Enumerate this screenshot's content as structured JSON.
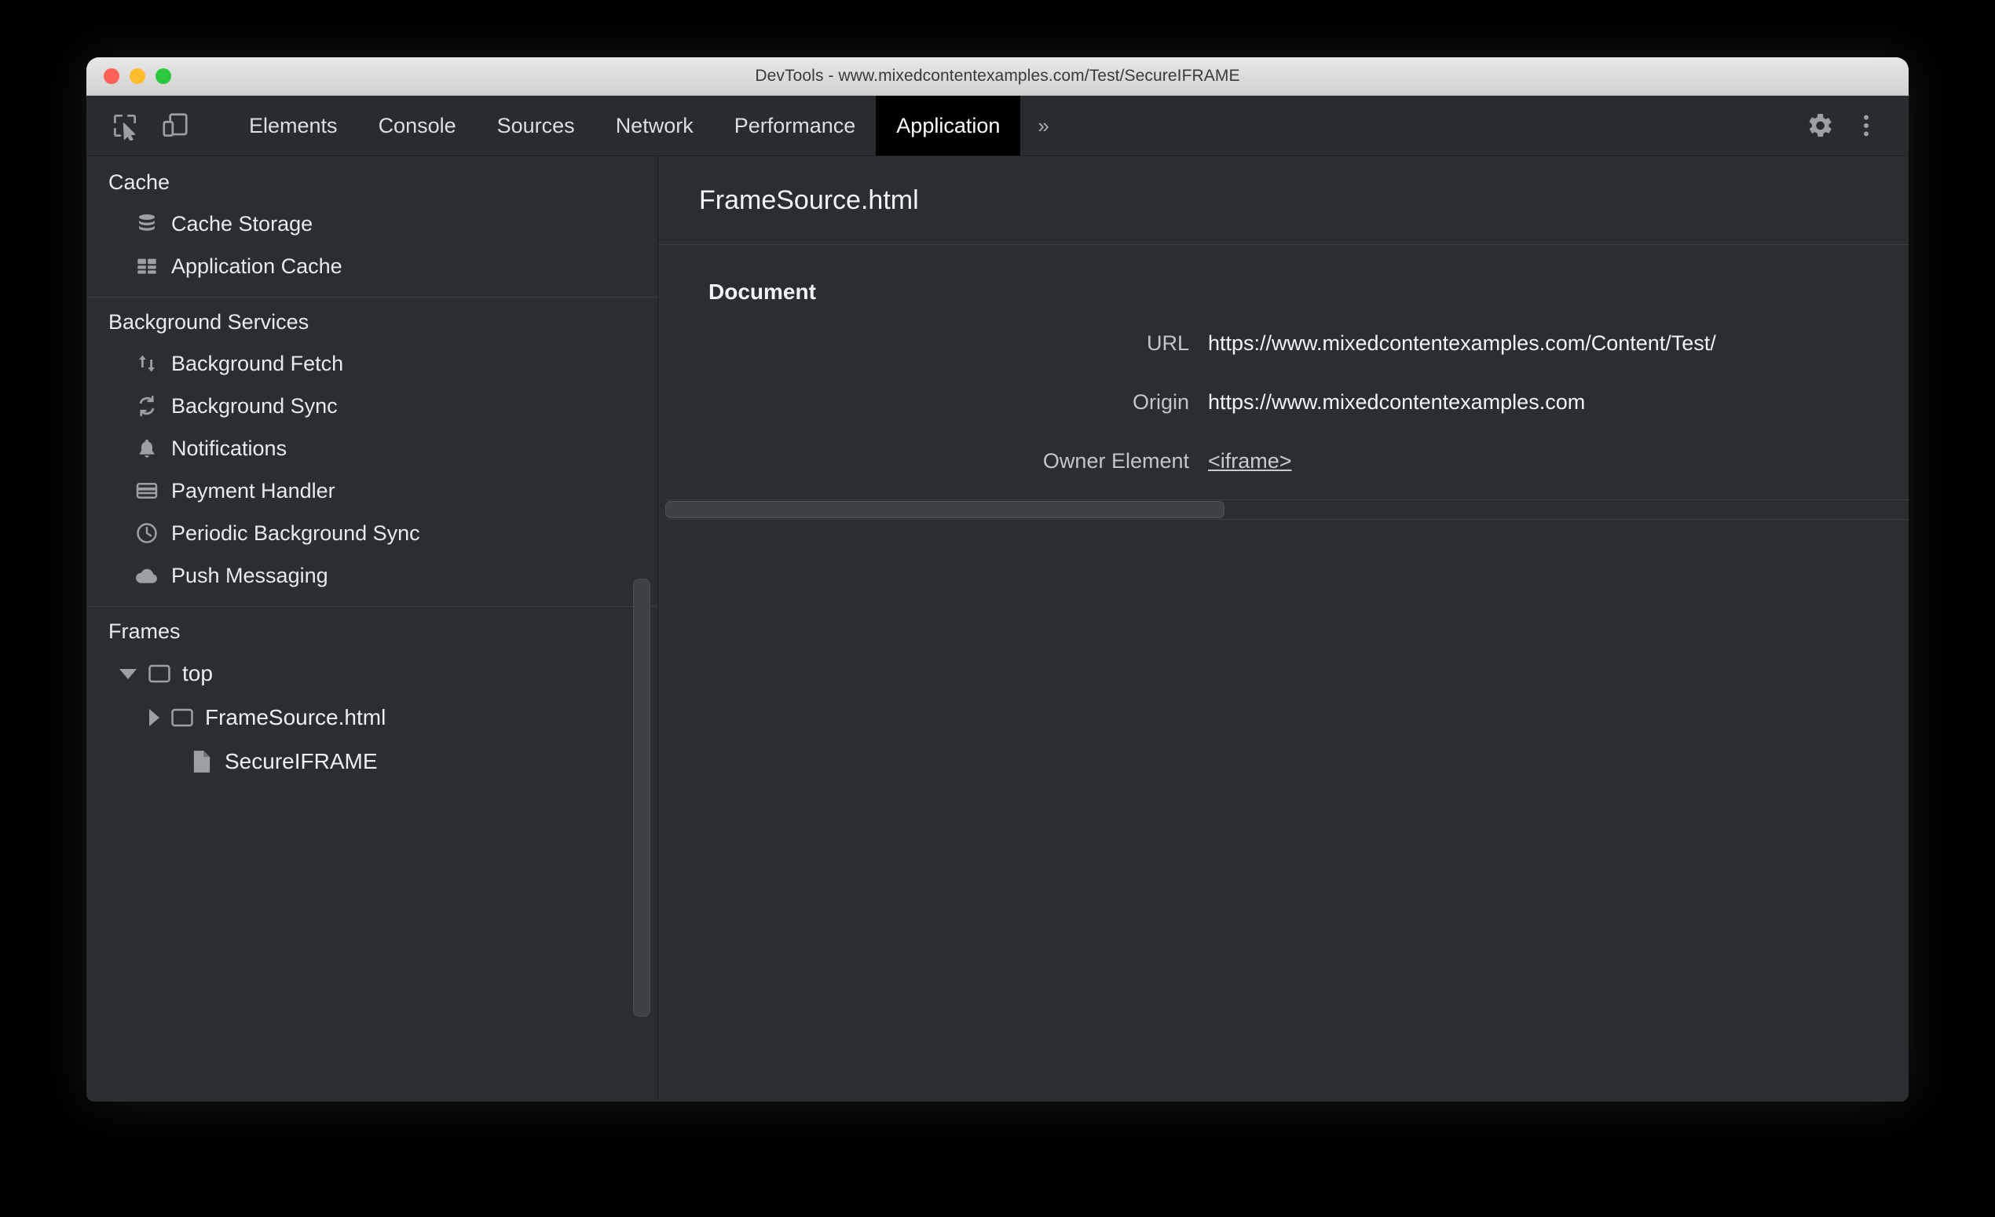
{
  "window": {
    "title": "DevTools - www.mixedcontentexamples.com/Test/SecureIFRAME"
  },
  "toolbar": {
    "inspect_icon": "inspect-element-icon",
    "device_icon": "device-toolbar-icon",
    "settings_icon": "gear-icon",
    "menu_icon": "more-vertical-icon",
    "more_tabs_label": "»",
    "tabs": [
      {
        "label": "Elements",
        "selected": false
      },
      {
        "label": "Console",
        "selected": false
      },
      {
        "label": "Sources",
        "selected": false
      },
      {
        "label": "Network",
        "selected": false
      },
      {
        "label": "Performance",
        "selected": false
      },
      {
        "label": "Application",
        "selected": true
      }
    ]
  },
  "sidebar": {
    "sections": [
      {
        "title": "Cache",
        "items": [
          {
            "label": "Cache Storage",
            "icon": "database-icon"
          },
          {
            "label": "Application Cache",
            "icon": "grid-icon"
          }
        ]
      },
      {
        "title": "Background Services",
        "items": [
          {
            "label": "Background Fetch",
            "icon": "arrows-up-down-icon"
          },
          {
            "label": "Background Sync",
            "icon": "sync-icon"
          },
          {
            "label": "Notifications",
            "icon": "bell-icon"
          },
          {
            "label": "Payment Handler",
            "icon": "credit-card-icon"
          },
          {
            "label": "Periodic Background Sync",
            "icon": "clock-icon"
          },
          {
            "label": "Push Messaging",
            "icon": "cloud-icon"
          }
        ]
      }
    ],
    "frames": {
      "title": "Frames",
      "tree": [
        {
          "label": "top",
          "icon": "frame-icon",
          "expander": "down",
          "depth": 1,
          "selected": false
        },
        {
          "label": "FrameSource.html",
          "icon": "frame-icon",
          "expander": "right",
          "depth": 2,
          "selected": true
        },
        {
          "label": "SecureIFRAME",
          "icon": "document-icon",
          "expander": "none",
          "depth": 3,
          "selected": false
        }
      ]
    }
  },
  "main": {
    "title": "FrameSource.html",
    "document_heading": "Document",
    "fields": [
      {
        "label": "URL",
        "value": "https://www.mixedcontentexamples.com/Content/Test/",
        "is_link": false
      },
      {
        "label": "Origin",
        "value": "https://www.mixedcontentexamples.com",
        "is_link": false
      },
      {
        "label": "Owner Element",
        "value": "<iframe>",
        "is_link": true
      }
    ]
  },
  "colors": {
    "panel_bg": "#2b2e31",
    "selected_tab_bg": "#000000",
    "selected_row_bg": "#4a4d50",
    "text_primary": "#f2f4f5",
    "text_secondary": "#c2c6c9",
    "icon_gray": "#9aa0a4"
  }
}
